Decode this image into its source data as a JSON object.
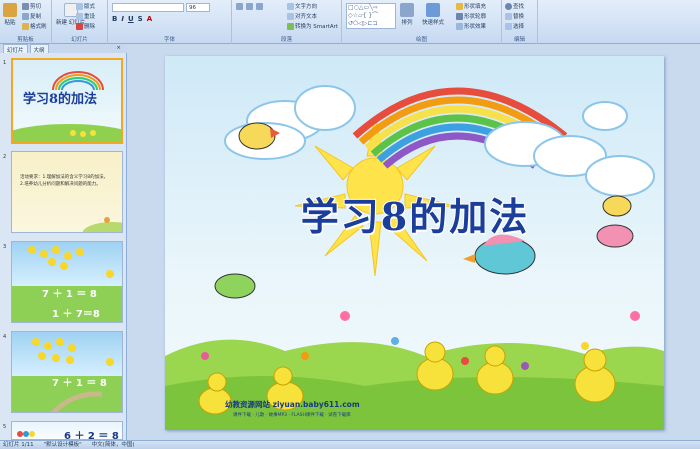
{
  "ribbon": {
    "clipboard": {
      "paste": "粘贴",
      "cut": "剪切",
      "copy": "复制",
      "format_painter": "格式刷",
      "label": "剪贴板"
    },
    "slides": {
      "new_slide": "新建\n幻灯片",
      "layout": "版式",
      "reset": "重设",
      "delete": "删除",
      "label": "幻灯片"
    },
    "font": {
      "font_size": "96",
      "label": "字体"
    },
    "paragraph": {
      "text_direction": "文字方向",
      "align_text": "对齐文本",
      "smartart": "转换为 SmartArt",
      "label": "段落"
    },
    "drawing": {
      "arrange": "排列",
      "quick_styles": "快速样式",
      "shape_fill": "形状填充",
      "shape_outline": "形状轮廓",
      "shape_effects": "形状效果",
      "label": "绘图"
    },
    "editing": {
      "find": "查找",
      "replace": "替换",
      "select": "选择",
      "label": "编辑"
    }
  },
  "panel": {
    "tab_slides": "幻灯片",
    "tab_outline": "大纲",
    "close": "×",
    "thumbs": [
      {
        "num": "1",
        "title": "学习8的加法"
      },
      {
        "num": "2",
        "text": "活动要求：1.理解加法的含义学习8的加法，2.培养幼儿分析问题和解决问题的能力。"
      },
      {
        "num": "3",
        "eq1": "7 ＋ 1 ＝ 8",
        "eq2": "1 ＋ 7＝8"
      },
      {
        "num": "4",
        "eq1": "7 ＋ 1 ＝ 8"
      },
      {
        "num": "5",
        "eq1": "6 ＋ 2 ＝ 8"
      }
    ]
  },
  "slide": {
    "title": "学习8的加法",
    "credit": "幼教资源网站  ziyuan.baby611.com",
    "credit_sub": "课件下载 · 儿歌 · 故事MP3 · FLASH课件下载 · 试卷下载库"
  },
  "status": {
    "slide_info": "幻灯片 1/11",
    "theme": "\"默认设计模板\"",
    "language": "中文(简体，中国)"
  }
}
